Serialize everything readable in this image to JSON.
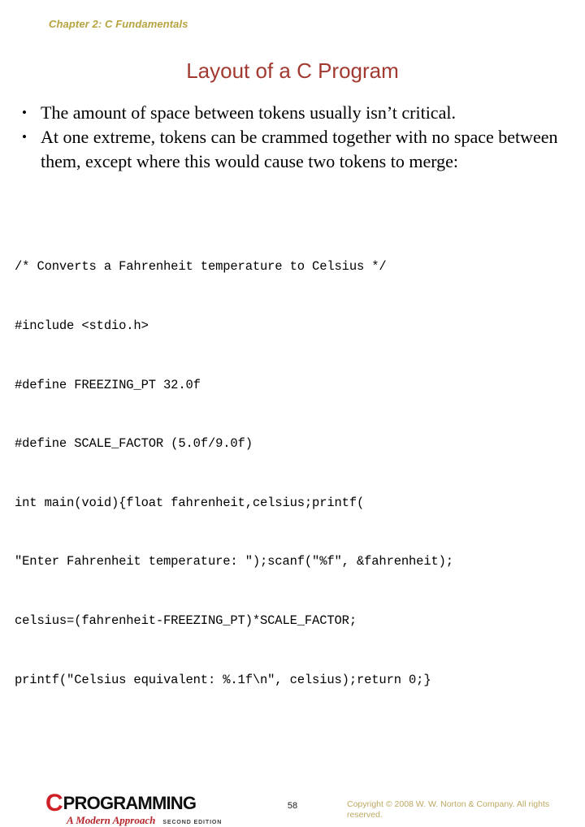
{
  "slide": {
    "chapter_header": "Chapter 2: C Fundamentals",
    "title": "Layout of a C Program",
    "bullets": [
      {
        "marker": "•",
        "text": "The amount of space between tokens usually isn’t critical."
      },
      {
        "marker": "•",
        "text": "At one extreme, tokens can be crammed together with no space between them, except where this would cause two tokens to merge:"
      }
    ],
    "code_lines": [
      "/* Converts a Fahrenheit temperature to Celsius */",
      "#include <stdio.h>",
      "#define FREEZING_PT 32.0f",
      "#define SCALE_FACTOR (5.0f/9.0f)",
      "int main(void){float fahrenheit,celsius;printf(",
      "\"Enter Fahrenheit temperature: \");scanf(\"%f\", &fahrenheit);",
      "celsius=(fahrenheit-FREEZING_PT)*SCALE_FACTOR;",
      "printf(\"Celsius equivalent: %.1f\\n\", celsius);return 0;}"
    ]
  },
  "footer": {
    "logo": {
      "letter": "C",
      "word": "PROGRAMMING",
      "tagline": "A Modern Approach",
      "edition": "SECOND EDITION"
    },
    "page_number": "58",
    "copyright": "Copyright © 2008 W. W. Norton & Company. All rights reserved."
  },
  "colors": {
    "chapter_header": "#b6a33f",
    "title": "#a33a31",
    "body_text": "#000000",
    "logo_red": "#cf2027",
    "copyright": "#bda960",
    "background": "#ffffff"
  }
}
